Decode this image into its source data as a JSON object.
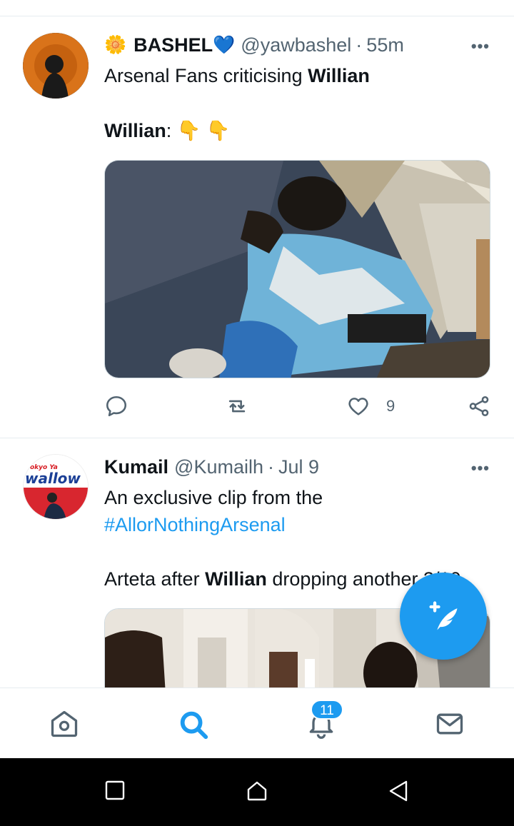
{
  "tweets": [
    {
      "badge_emoji": "🌼",
      "name": "BASHEL",
      "verified_emoji": "💙",
      "handle": "@yawbashel",
      "separator": "·",
      "time": "55m",
      "more": "•••",
      "line1_prefix": "Arsenal Fans criticising ",
      "line1_bold": "Willian",
      "line2_bold": "Willian",
      "line2_suffix": ": 👇 👇",
      "media_icon": "sleeping-man-photo",
      "actions": {
        "reply_icon": "reply-icon",
        "retweet_icon": "retweet-icon",
        "like_icon": "heart-icon",
        "like_count": "9",
        "share_icon": "share-icon"
      }
    },
    {
      "name": "Kumail",
      "handle": "@Kumailh",
      "separator": "·",
      "time": "Jul 9",
      "more": "•••",
      "line1": "An exclusive clip from the",
      "hashtag": "#AllorNothingArsenal",
      "line3_prefix": "Arteta after ",
      "line3_bold": "Willian",
      "line3_suffix": " dropping another 3/10",
      "avatar_text": "wallow"
    }
  ],
  "fab": {
    "icon": "compose-tweet-icon"
  },
  "bottom_nav": {
    "home_icon": "home-icon",
    "search_icon": "search-icon",
    "notifications_icon": "bell-icon",
    "notifications_badge": "11",
    "messages_icon": "mail-icon"
  },
  "system_nav": {
    "recents_icon": "recents-square-icon",
    "home_icon": "home-outline-icon",
    "back_icon": "back-triangle-icon"
  },
  "colors": {
    "accent": "#1d9bf0",
    "text": "#0f1419",
    "secondary": "#536471"
  }
}
